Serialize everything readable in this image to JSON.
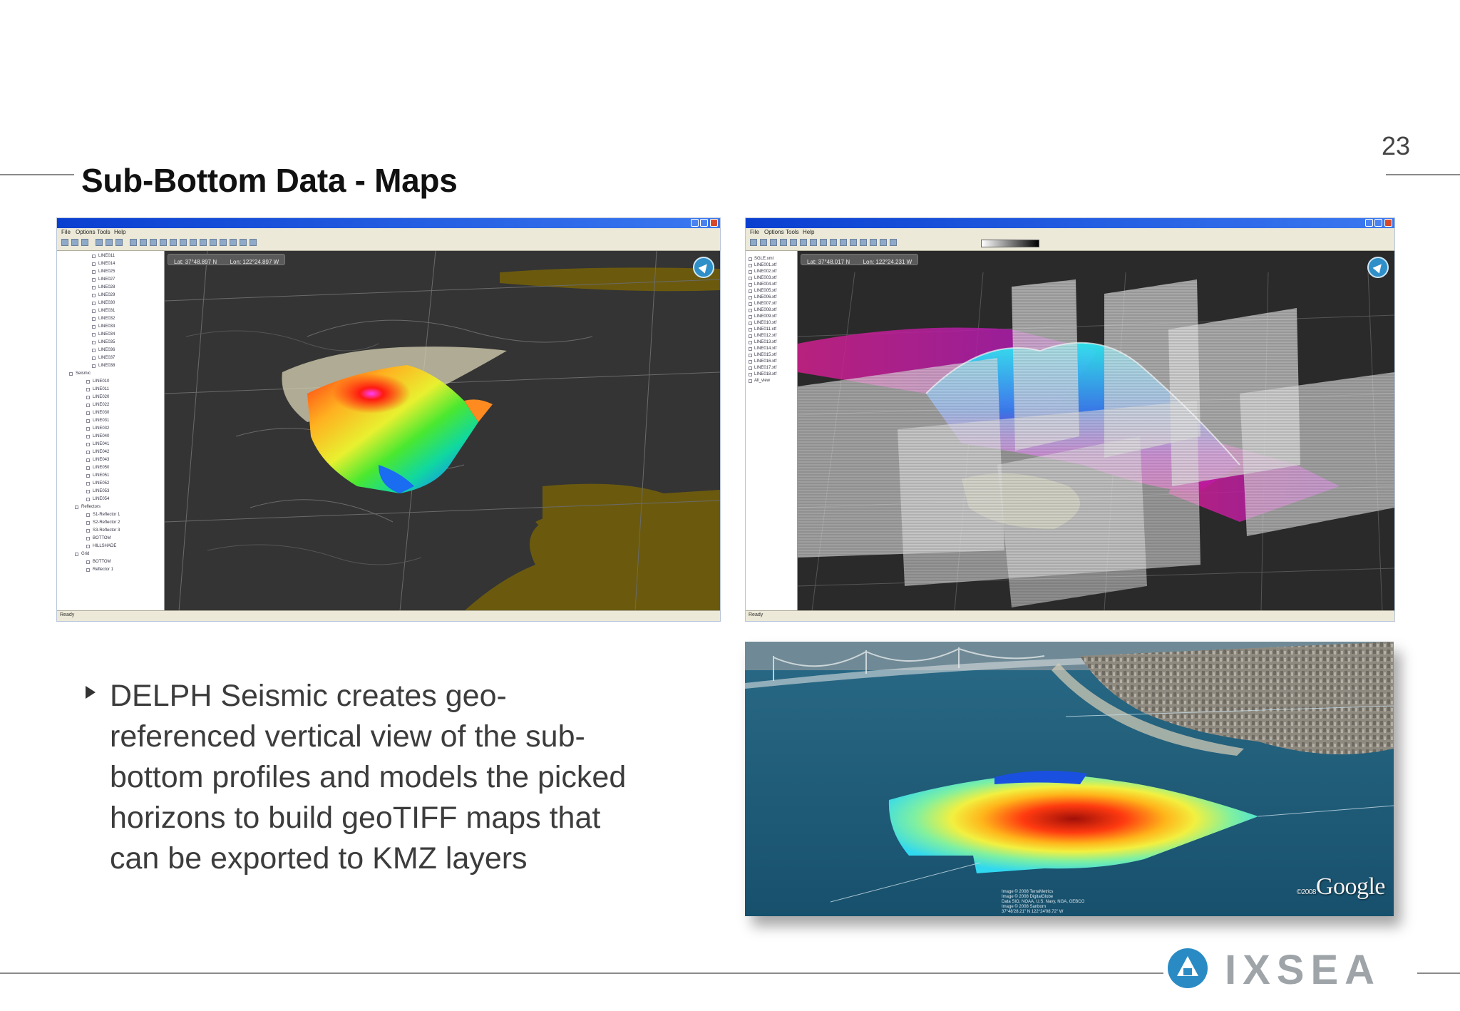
{
  "slide": {
    "page_number": "23",
    "title": "Sub-Bottom Data - Maps",
    "bullet": "DELPH Seismic creates geo-referenced vertical view of the sub-bottom profiles and models the picked horizons to build geoTIFF maps that can be exported to KMZ layers",
    "bullet_lines": [
      "DELPH Seismic creates geo-",
      "referenced vertical view of the sub-",
      "bottom profiles and models the picked",
      "horizons to build geoTIFF maps that",
      "can be exported to KMZ layers"
    ]
  },
  "screenshot_left": {
    "menu": [
      "File",
      "Options",
      "Tools",
      "Help"
    ],
    "coord_lat": "Lat:  37°48.897 N",
    "coord_lon": "Lon:  122°24.897 W",
    "status_left": "Ready",
    "tree_top_items": [
      "LINE011",
      "LINE014",
      "LINE025",
      "LINE027",
      "LINE028",
      "LINE029",
      "LINE030",
      "LINE031",
      "LINE032",
      "LINE033",
      "LINE034",
      "LINE035",
      "LINE036",
      "LINE037",
      "LINE038"
    ],
    "tree_seismic": "Seismic",
    "tree_sub_items": [
      "LINE010",
      "LINE011",
      "LINE020",
      "LINE022",
      "LINE030",
      "LINE031",
      "LINE032",
      "LINE040",
      "LINE041",
      "LINE042",
      "LINE043",
      "LINE050",
      "LINE051",
      "LINE052",
      "LINE053",
      "LINE054"
    ],
    "tree_reflectors": "Reflectors",
    "tree_reflector_items": [
      "S1-Reflector 1",
      "S2-Reflector 2",
      "S3-Reflector 3",
      "BOTTOM",
      "HILLSHADE"
    ],
    "tree_grid": "Grid",
    "tree_grid_items": [
      "BOTTOM",
      "Reflector 1"
    ],
    "colors": {
      "land": "#6b5a0e",
      "water": "#343434"
    }
  },
  "screenshot_right": {
    "menu": [
      "File",
      "Options",
      "Tools",
      "Help"
    ],
    "coord_lat": "Lat:  37°48.017 N",
    "coord_lon": "Lon:  122°24.231 W",
    "status_left": "Ready",
    "tree_items": [
      "SGLE.xml",
      "LINE001.xtf",
      "LINE002.xtf",
      "LINE003.xtf",
      "LINE004.xtf",
      "LINE005.xtf",
      "LINE006.xtf",
      "LINE007.xtf",
      "LINE008.xtf",
      "LINE009.xtf",
      "LINE010.xtf",
      "LINE011.xtf",
      "LINE012.xtf",
      "LINE013.xtf",
      "LINE014.xtf",
      "LINE015.xtf",
      "LINE016.xtf",
      "LINE017.xtf",
      "LINE018.xtf",
      "All_view"
    ]
  },
  "screenshot_bottom": {
    "logo": "Google",
    "logo_prefix": "©2008",
    "credits": [
      "Image © 2008 TerraMetrics",
      "Image © 2008 DigitalGlobe",
      "Data SIO, NOAA, U.S. Navy, NGA, GEBCO",
      "Image © 2008 Sanborn"
    ],
    "status": "37°48'28.21\" N   122°24'08.72\" W"
  },
  "footer": {
    "company": "IXSEA",
    "brand_color": "#2a8bc4"
  }
}
